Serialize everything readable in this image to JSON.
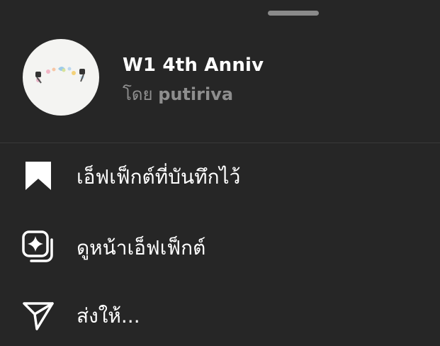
{
  "effect": {
    "name": "W1 4th Anniv",
    "by_prefix": "โดย",
    "author": "putiriva"
  },
  "menu": {
    "items": [
      {
        "id": "saved",
        "label": "เอ็ฟเฟ็กต์ที่บันทึกไว้",
        "icon": "bookmark-icon"
      },
      {
        "id": "view",
        "label": "ดูหน้าเอ็ฟเฟ็กต์",
        "icon": "effect-sparkle-icon"
      },
      {
        "id": "send",
        "label": "ส่งให้...",
        "icon": "send-icon"
      }
    ]
  },
  "colors": {
    "background": "#262626",
    "text": "#ffffff",
    "secondary_text": "#8e8e8e",
    "divider": "#3a3a3a",
    "grabber": "#8a8a8a"
  }
}
